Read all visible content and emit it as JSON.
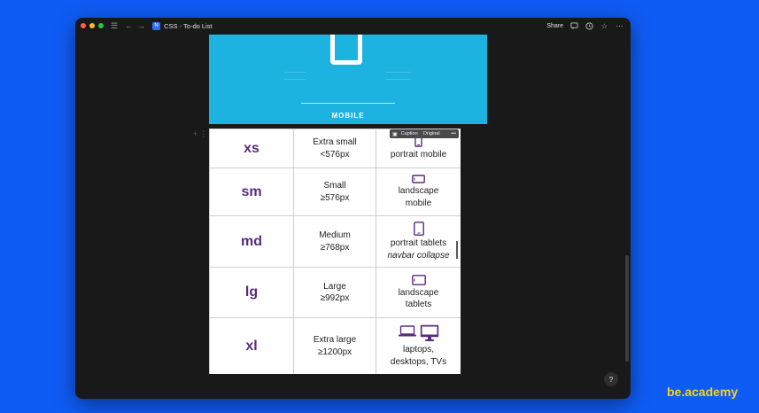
{
  "window": {
    "title": "CSS - To-do List",
    "app_icon": "notion-app-icon",
    "share_label": "Share",
    "help_label": "?"
  },
  "banner": {
    "label": "MOBILE",
    "background": "#1cb3e0"
  },
  "image_toolbar": {
    "caption_label": "Caption",
    "original_label": "Original",
    "more_label": "•••"
  },
  "table": {
    "rows": [
      {
        "size": "xs",
        "name": "Extra small",
        "min": "<576px",
        "icon": "phone-portrait-icon",
        "desc": [
          "portrait mobile"
        ]
      },
      {
        "size": "sm",
        "name": "Small",
        "min": "≥576px",
        "icon": "phone-landscape-icon",
        "desc": [
          "landscape",
          "mobile"
        ]
      },
      {
        "size": "md",
        "name": "Medium",
        "min": "≥768px",
        "icon": "tablet-portrait-icon",
        "desc": [
          "portrait tablets"
        ],
        "note": "navbar collapse"
      },
      {
        "size": "lg",
        "name": "Large",
        "min": "≥992px",
        "icon": "tablet-landscape-icon",
        "desc": [
          "landscape",
          "tablets"
        ]
      },
      {
        "size": "xl",
        "name": "Extra large",
        "min": "≥1200px",
        "icon": "laptop-desktop-icon",
        "desc": [
          "laptops,",
          "desktops, TVs"
        ]
      }
    ]
  },
  "brand": {
    "text": "be.academy",
    "color": "#f6d31a"
  },
  "colors": {
    "background": "#0f5cf5",
    "window": "#191919",
    "breakpoint_purple": "#5a2a80"
  }
}
